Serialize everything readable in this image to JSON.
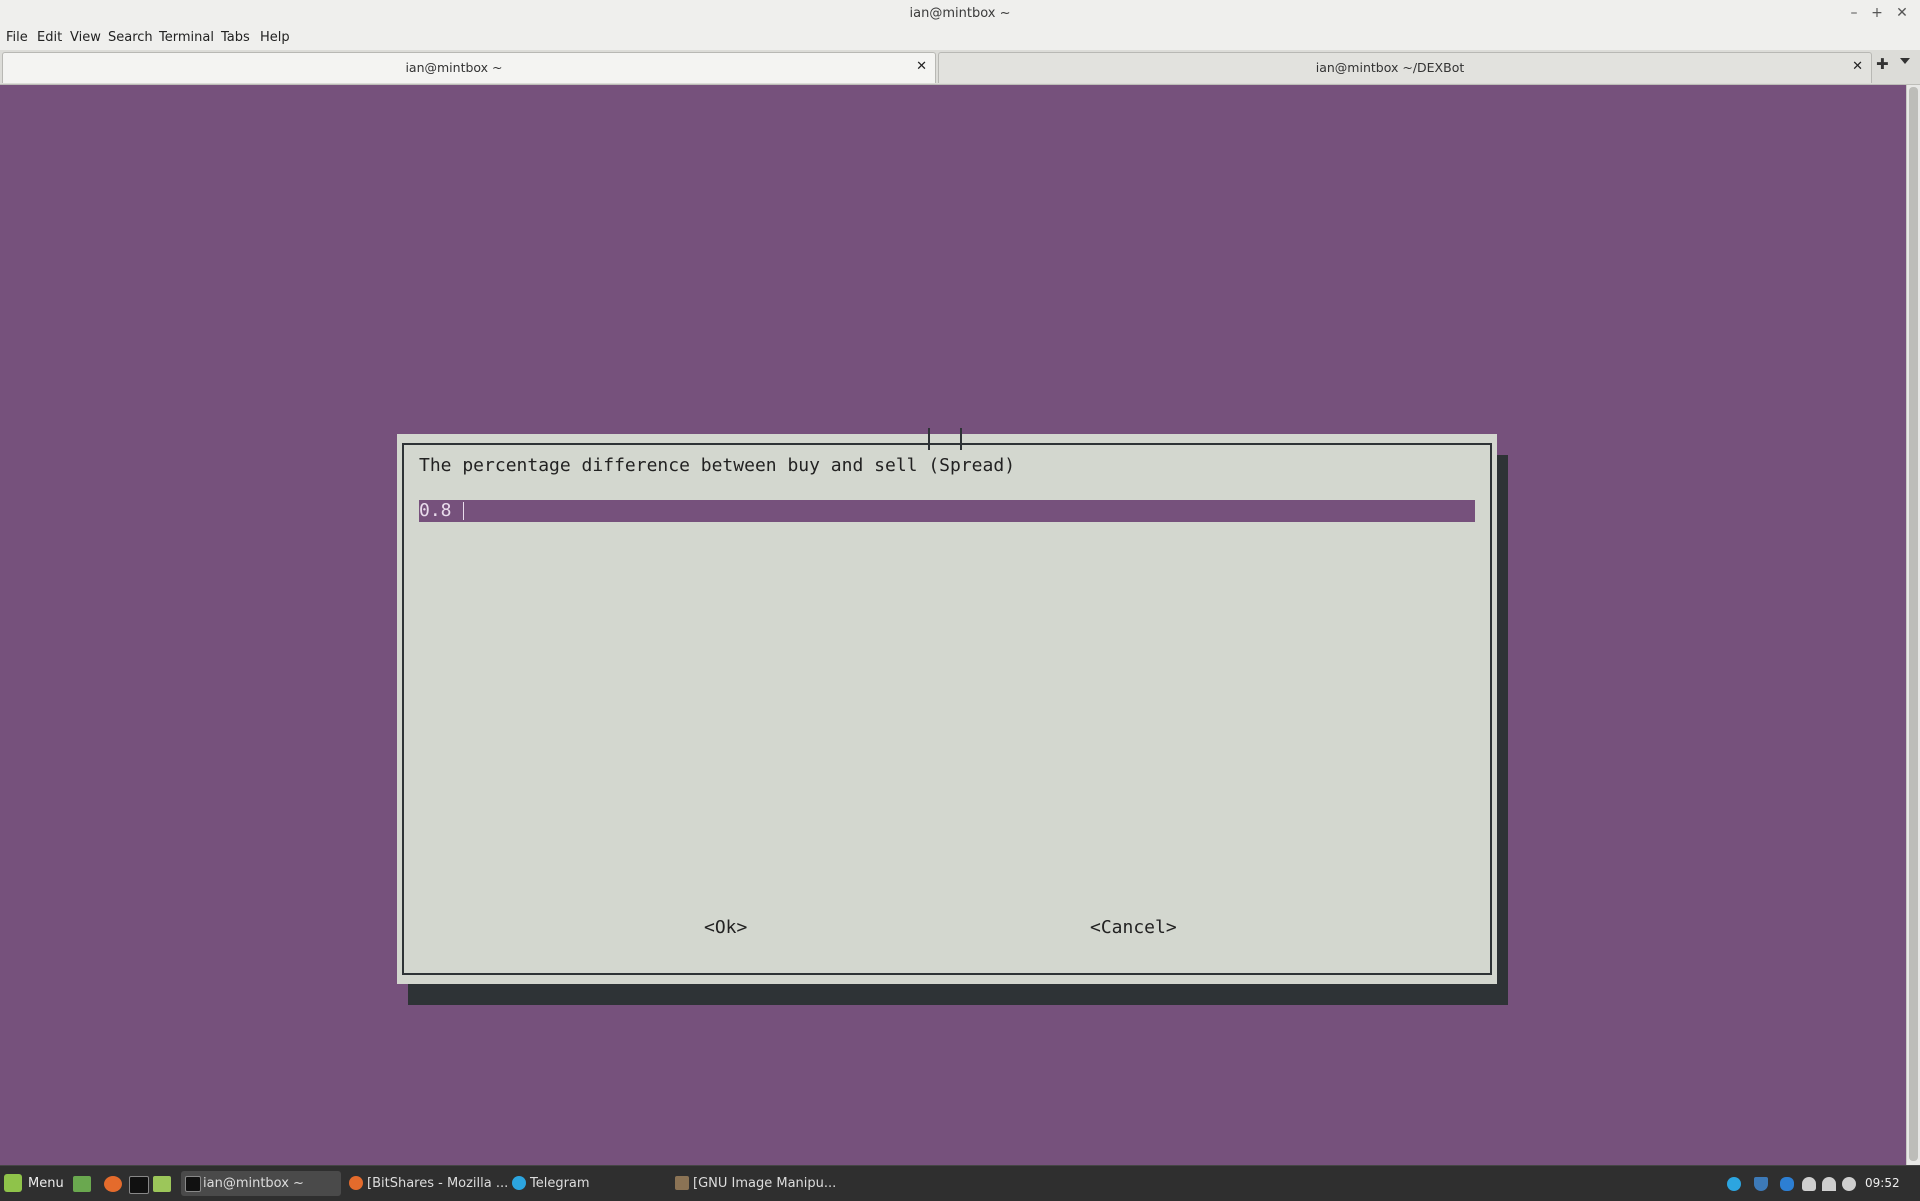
{
  "window": {
    "title": "ian@mintbox ~",
    "controls": [
      "–",
      "+",
      "✕"
    ]
  },
  "menubar": [
    "File",
    "Edit",
    "View",
    "Search",
    "Terminal",
    "Tabs",
    "Help"
  ],
  "tabs": [
    {
      "label": "ian@mintbox ~",
      "close": "✕"
    },
    {
      "label": "ian@mintbox ~/DEXBot",
      "close": "✕"
    }
  ],
  "dialog": {
    "prompt": "The percentage difference between buy and sell (Spread)",
    "input_value": "0.8",
    "ok_label": "<Ok>",
    "cancel_label": "<Cancel>"
  },
  "taskbar": {
    "menu_label": "Menu",
    "tasks": [
      {
        "label": "ian@mintbox ~",
        "icon": "terminal-icon"
      },
      {
        "label": "[BitShares - Mozilla ...",
        "icon": "firefox-icon"
      },
      {
        "label": "Telegram",
        "icon": "telegram-icon"
      },
      {
        "label": "[GNU Image Manipu...",
        "icon": "gimp-icon"
      }
    ],
    "clock": "09:52"
  },
  "colors": {
    "terminal_bg": "#76517c",
    "dialog_bg": "#d3d7cf",
    "dialog_shadow": "#2e3336",
    "taskbar_bg": "#2f2f2f"
  }
}
